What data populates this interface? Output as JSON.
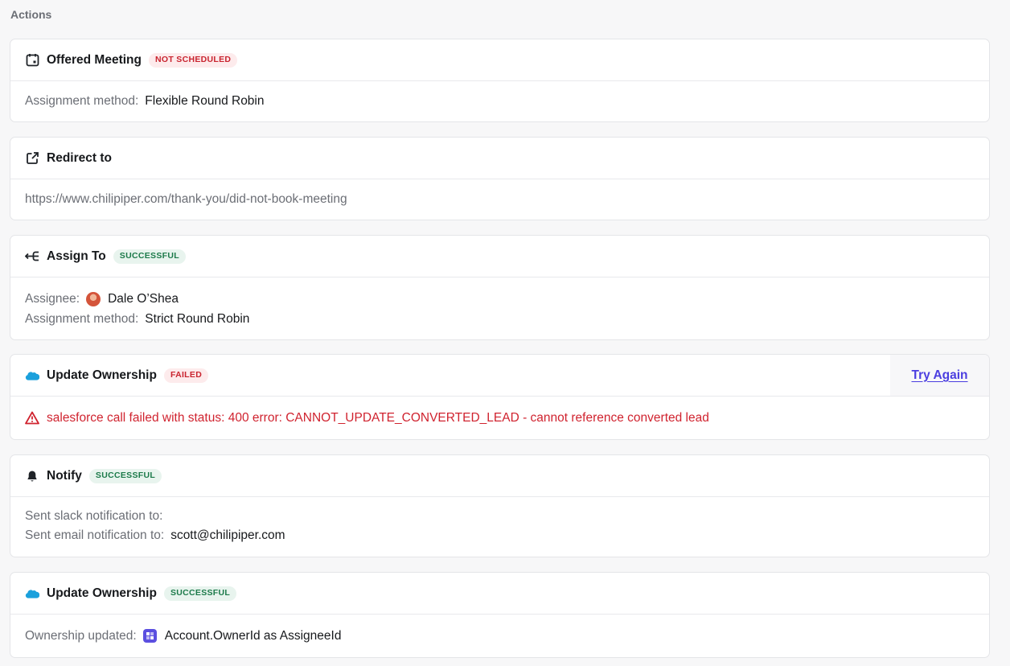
{
  "section": {
    "title": "Actions"
  },
  "offered_meeting": {
    "title": "Offered Meeting",
    "badge": "NOT SCHEDULED",
    "method_label": "Assignment method:",
    "method_value": "Flexible Round Robin"
  },
  "redirect": {
    "title": "Redirect to",
    "url": "https://www.chilipiper.com/thank-you/did-not-book-meeting"
  },
  "assign_to": {
    "title": "Assign To",
    "badge": "SUCCESSFUL",
    "assignee_label": "Assignee:",
    "assignee_name": "Dale O’Shea",
    "method_label": "Assignment method:",
    "method_value": "Strict Round Robin"
  },
  "update_ownership_failed": {
    "title": "Update Ownership",
    "badge": "FAILED",
    "action_label": "Try Again",
    "error": "salesforce call failed with status: 400 error: CANNOT_UPDATE_CONVERTED_LEAD - cannot reference converted lead"
  },
  "notify": {
    "title": "Notify",
    "badge": "SUCCESSFUL",
    "slack_label": "Sent slack notification to:",
    "email_label": "Sent email notification to:",
    "email_value": "scott@chilipiper.com"
  },
  "update_ownership_success": {
    "title": "Update Ownership",
    "badge": "SUCCESSFUL",
    "label": "Ownership updated:",
    "value": "Account.OwnerId as AssigneeId"
  },
  "icons": {
    "offered_meeting": "calendar-icon",
    "redirect": "external-link-icon",
    "assign_to": "assign-arrow-icon",
    "update_ownership": "salesforce-cloud-icon",
    "notify": "bell-icon",
    "error": "warning-triangle-icon",
    "object": "object-field-icon"
  },
  "colors": {
    "background": "#f7f7f8",
    "failed": "#c9242f",
    "success": "#1c7a4a",
    "link": "#4b3ee0",
    "salesforce": "#1ba0dc"
  }
}
